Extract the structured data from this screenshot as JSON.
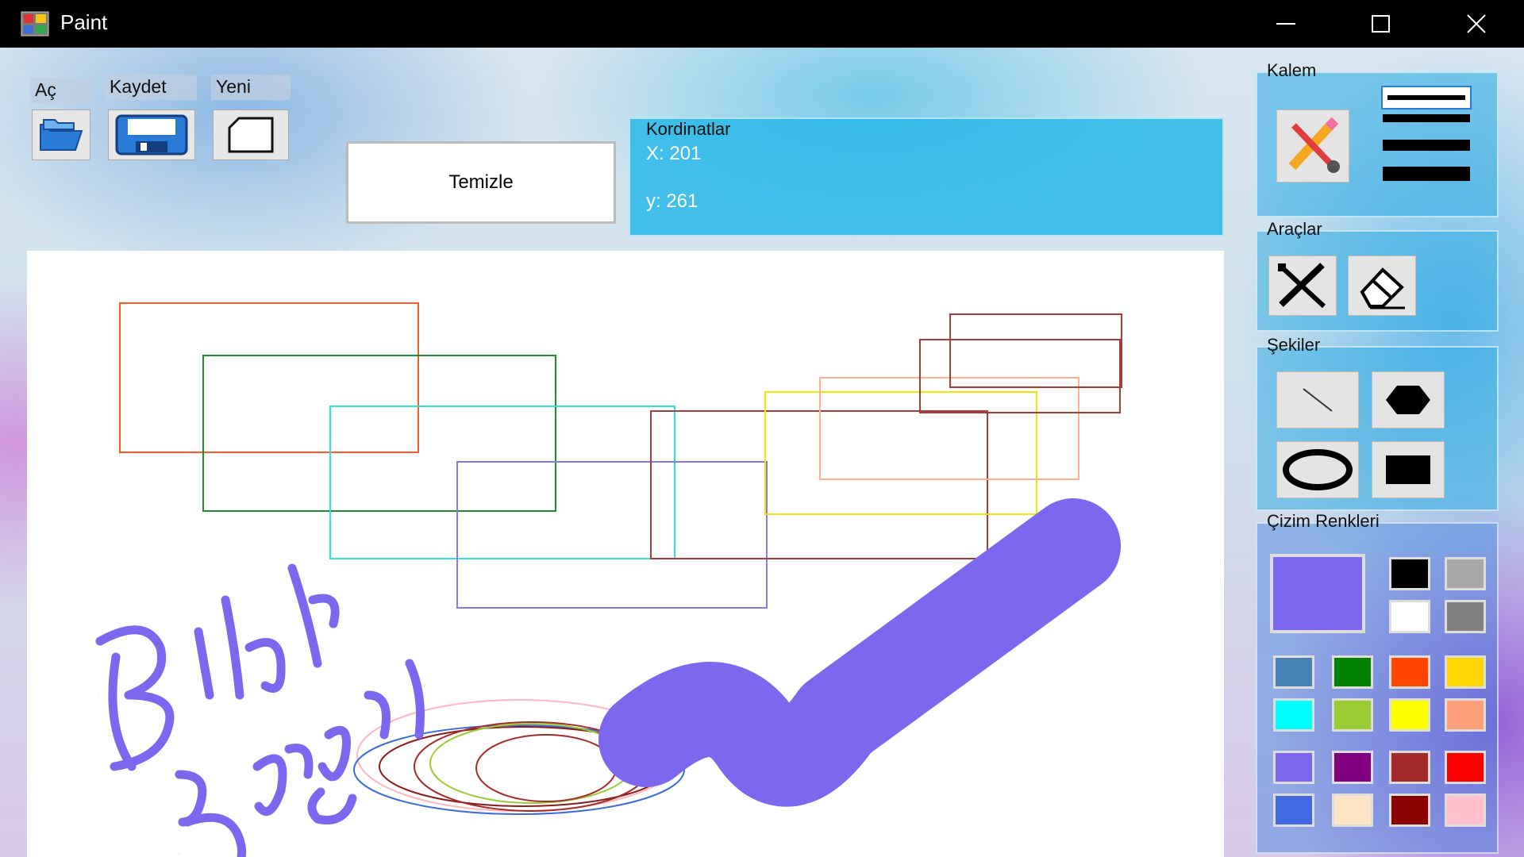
{
  "window": {
    "title": "Paint"
  },
  "file_toolbar": {
    "open_label": "Aç",
    "save_label": "Kaydet",
    "new_label": "Yeni",
    "clear_label": "Temizle"
  },
  "coordinates": {
    "title": "Kordinatlar",
    "x_text": "X: 201",
    "y_text": "y: 261"
  },
  "pen": {
    "title": "Kalem",
    "widths": [
      "thin",
      "medium",
      "thick",
      "extra-thick"
    ],
    "selected_width_index": 0
  },
  "tools": {
    "title": "Araçlar",
    "items": [
      "pen-tool-icon",
      "eraser-icon"
    ]
  },
  "shapes": {
    "title": "Şekiler",
    "items": [
      "line-icon",
      "hexagon-icon",
      "ellipse-icon",
      "rectangle-icon"
    ]
  },
  "colors": {
    "title": "Çizim Renkleri",
    "current": "#7B68EE",
    "swatches": [
      "#000000",
      "#A9A9A9",
      "#FFFFFF",
      "#808080",
      "#4682B4",
      "#008000",
      "#FF4500",
      "#FFD700",
      "#00FFFF",
      "#9ACD32",
      "#FFFF00",
      "#FFA07A",
      "#7B68EE",
      "#800080",
      "#A52A2A",
      "#FF0000",
      "#4169E1",
      "#FFE4C4",
      "#8B0000",
      "#FFC0CB"
    ]
  },
  "canvas": {
    "handwriting_line1": "Bilal",
    "handwriting_line2": "Şengül"
  }
}
